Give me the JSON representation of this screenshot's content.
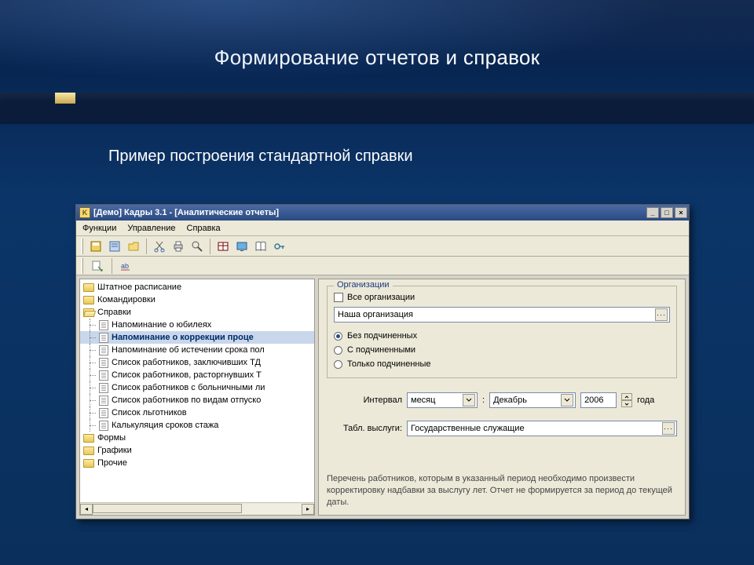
{
  "slide": {
    "title": "Формирование отчетов и справок",
    "subtitle": "Пример построения стандартной справки"
  },
  "app": {
    "title": "[Демо] Кадры 3.1 - [Аналитические отчеты]",
    "menu": {
      "functions": "Функции",
      "manage": "Управление",
      "help": "Справка"
    }
  },
  "tree": {
    "items": [
      "Штатное расписание",
      "Командировки",
      "Справки",
      "Напоминание о юбилеях",
      "Напоминание о коррекции проце",
      "Напоминание об истечении срока пол",
      "Список работников, заключивших ТД",
      "Список работников, расторгнувших Т",
      "Список работников с больничными ли",
      "Список работников по видам отпуско",
      "Список льготников",
      "Калькуляция сроков стажа",
      "Формы",
      "Графики",
      "Прочие"
    ]
  },
  "org": {
    "legend": "Организации",
    "all": "Все организации",
    "selected": "Наша организация",
    "r1": "Без подчиненных",
    "r2": "С подчиненными",
    "r3": "Только подчиненные"
  },
  "interval": {
    "label": "Интервал",
    "unit": "месяц",
    "colon": ":",
    "month": "Декабрь",
    "year": "2006",
    "year_suffix": "года"
  },
  "table": {
    "label": "Табл. выслуги:",
    "value": "Государственные служащие"
  },
  "hint": "Перечень работников, которым в указанный период необходимо произвести корректировку надбавки за выслугу лет. Отчет не формируется за период до текущей даты."
}
